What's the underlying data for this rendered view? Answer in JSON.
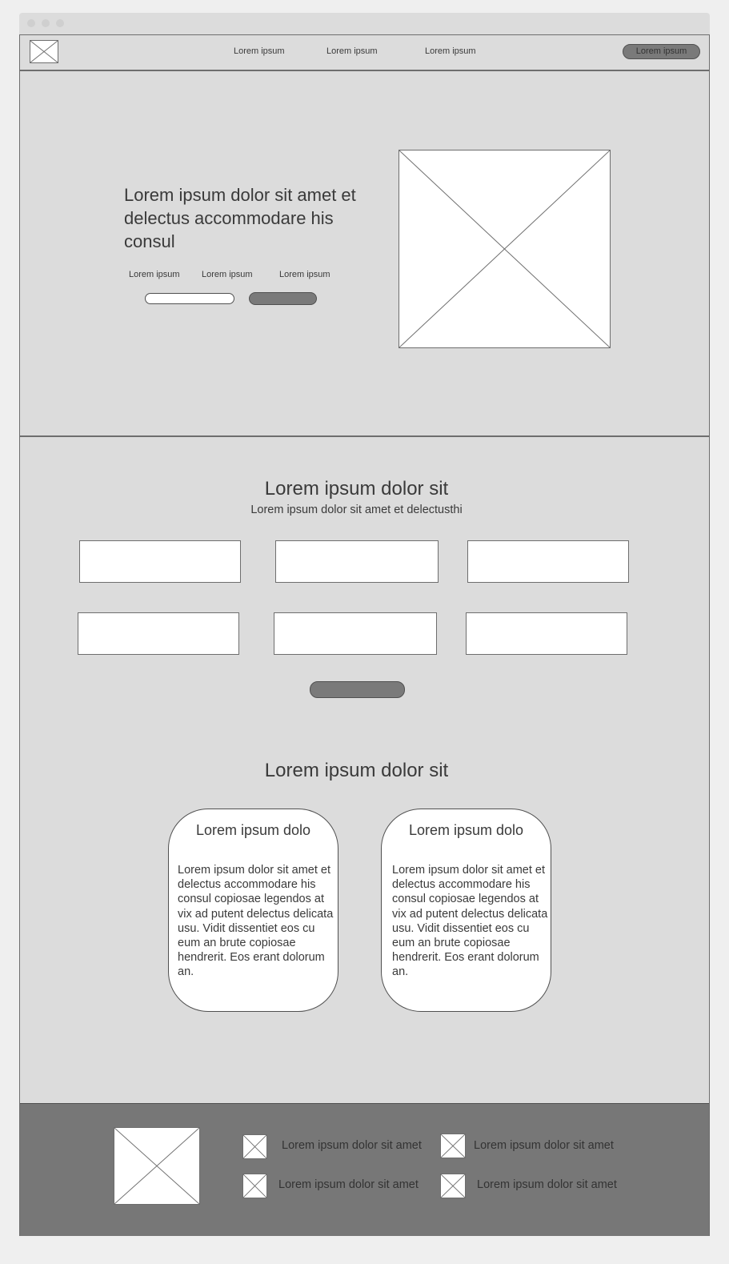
{
  "nav": {
    "links": [
      "Lorem ipsum",
      "Lorem ipsum",
      "Lorem ipsum"
    ],
    "cta_label": "Lorem ipsum"
  },
  "hero": {
    "title": "Lorem ipsum dolor sit amet et delectus accommodare his consul",
    "labels": [
      "Lorem ipsum",
      "Lorem ipsum",
      "Lorem ipsum"
    ]
  },
  "features": {
    "title": "Lorem ipsum dolor sit",
    "subtitle": "Lorem ipsum dolor sit amet et delectusthi"
  },
  "cards_section": {
    "title": "Lorem ipsum dolor sit",
    "cards": [
      {
        "title": "Lorem ipsum dolo",
        "body": "Lorem ipsum dolor sit amet et delectus accommodare his consul copiosae legendos at vix ad putent delectus delicata usu. Vidit dissentiet eos cu eum an brute copiosae hendrerit. Eos erant dolorum an."
      },
      {
        "title": "Lorem ipsum dolo",
        "body": "Lorem ipsum dolor sit amet et delectus accommodare his consul copiosae legendos at vix ad putent delectus delicata usu. Vidit dissentiet eos cu eum an brute copiosae hendrerit. Eos erant dolorum an."
      }
    ]
  },
  "footer": {
    "items": [
      "Lorem ipsum dolor sit amet",
      "Lorem ipsum dolor sit amet",
      "Lorem ipsum dolor sit amet",
      "Lorem ipsum dolor sit amet"
    ]
  },
  "colors": {
    "page_bg": "#efefef",
    "panel_bg": "#dcdcdc",
    "border": "#6e6e6e",
    "button_dark": "#7a7a7a",
    "footer_bg": "#777777",
    "text": "#3a3a3a"
  },
  "icons": {
    "logo": "image-placeholder-icon",
    "hero_image": "image-placeholder-icon",
    "footer_logo": "image-placeholder-icon",
    "footer_item": "image-placeholder-icon"
  }
}
